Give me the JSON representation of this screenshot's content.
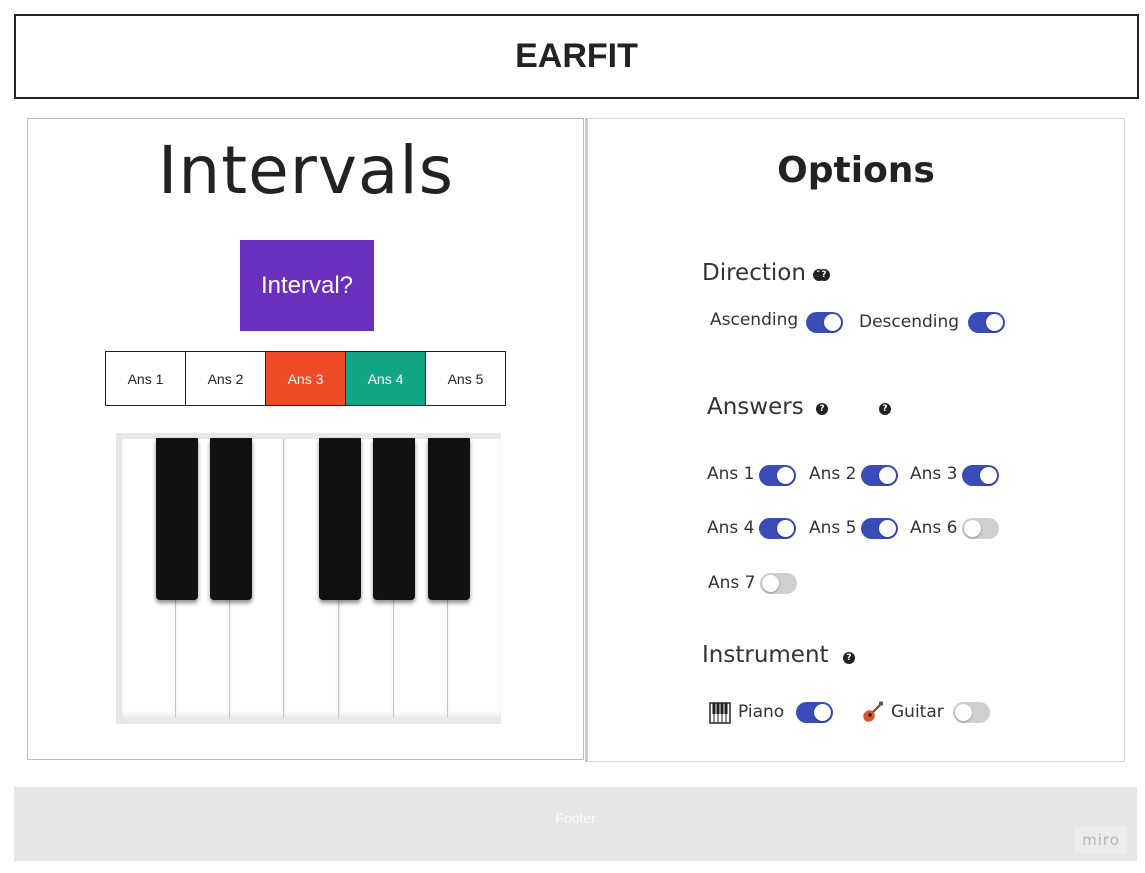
{
  "header": {
    "title": "EARFIT"
  },
  "left": {
    "title": "Intervals",
    "interval_button": "Interval?",
    "answers": [
      {
        "label": "Ans 1",
        "state": "default"
      },
      {
        "label": "Ans 2",
        "state": "default"
      },
      {
        "label": "Ans 3",
        "state": "wrong"
      },
      {
        "label": "Ans 4",
        "state": "correct"
      },
      {
        "label": "Ans 5",
        "state": "default"
      }
    ],
    "piano": {
      "icon": "piano-keyboard"
    }
  },
  "options": {
    "title": "Options",
    "direction": {
      "title": "Direction",
      "ascending": {
        "label": "Ascending",
        "on": true
      },
      "descending": {
        "label": "Descending",
        "on": true
      }
    },
    "answers": {
      "title": "Answers",
      "items": [
        {
          "label": "Ans 1",
          "on": true
        },
        {
          "label": "Ans 2",
          "on": true
        },
        {
          "label": "Ans 3",
          "on": true
        },
        {
          "label": "Ans 4",
          "on": true
        },
        {
          "label": "Ans 5",
          "on": true
        },
        {
          "label": "Ans 6",
          "on": false
        },
        {
          "label": "Ans 7",
          "on": false
        }
      ]
    },
    "instrument": {
      "title": "Instrument",
      "piano": {
        "label": "Piano",
        "on": true,
        "icon": "piano-icon"
      },
      "guitar": {
        "label": "Guitar",
        "on": false,
        "icon": "guitar-icon"
      }
    }
  },
  "footer": {
    "text": "Footer",
    "badge": "miro"
  },
  "colors": {
    "interval_button": "#6b2fbd",
    "wrong": "#ee4a26",
    "correct": "#12a584",
    "toggle_on": "#3a4cb8",
    "toggle_off": "#cfcfcf"
  }
}
